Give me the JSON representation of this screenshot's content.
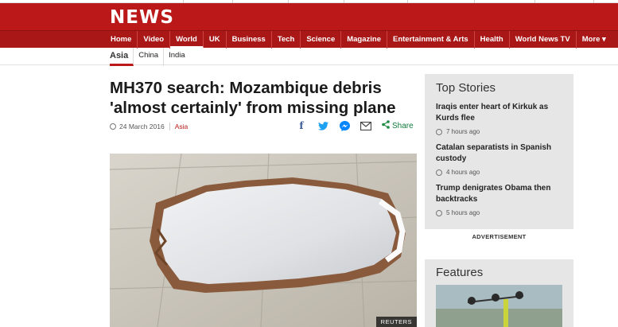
{
  "brand": {
    "logo_text": "NEWS",
    "accent": "#bb1919"
  },
  "nav": {
    "items": [
      "Home",
      "Video",
      "World",
      "UK",
      "Business",
      "Tech",
      "Science",
      "Magazine",
      "Entertainment & Arts",
      "Health",
      "World News TV",
      "More ▾"
    ],
    "active": "World"
  },
  "subnav": {
    "items": [
      "Asia",
      "China",
      "India"
    ],
    "active": "Asia"
  },
  "article": {
    "headline": "MH370 search: Mozambique debris 'almost certainly' from missing plane",
    "date": "24 March 2016",
    "section": "Asia",
    "share_label": "Share",
    "share_icons": [
      "facebook-icon",
      "twitter-icon",
      "messenger-icon",
      "email-icon",
      "share-icon"
    ],
    "image_credit": "REUTERS"
  },
  "sidebar": {
    "top_stories_title": "Top Stories",
    "stories": [
      {
        "title": "Iraqis enter heart of Kirkuk as Kurds flee",
        "time": "7 hours ago"
      },
      {
        "title": "Catalan separatists in Spanish custody",
        "time": "4 hours ago"
      },
      {
        "title": "Trump denigrates Obama then backtracks",
        "time": "5 hours ago"
      }
    ],
    "advertisement_label": "ADVERTISEMENT",
    "features_title": "Features"
  }
}
